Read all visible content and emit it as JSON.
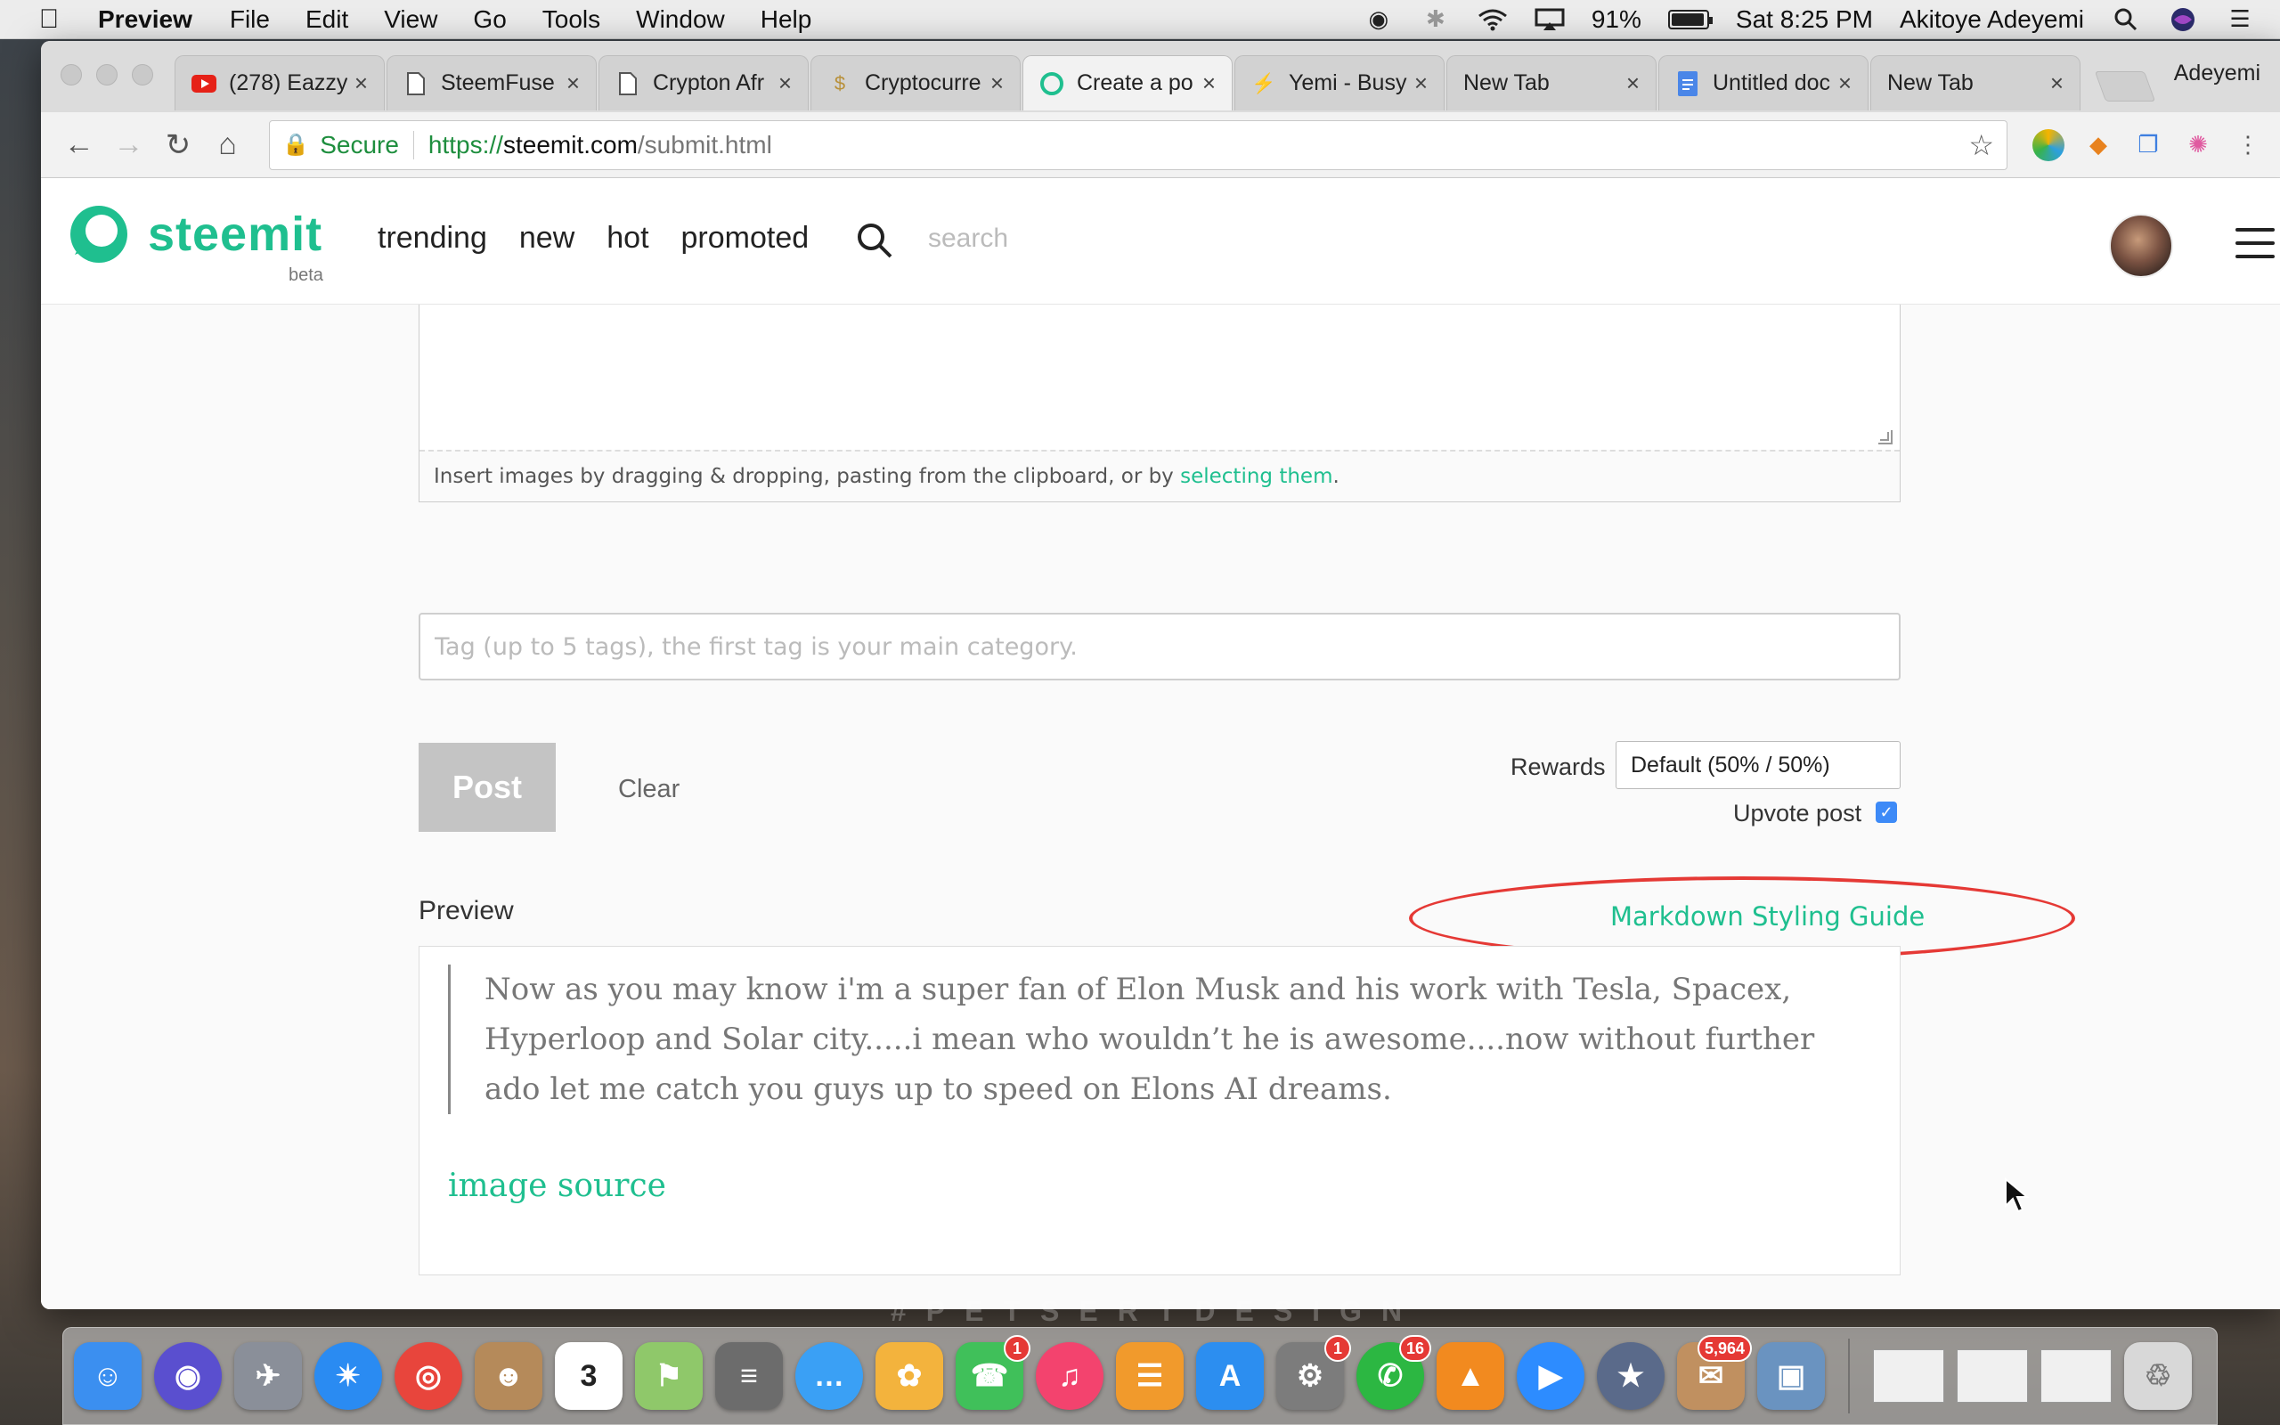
{
  "menubar": {
    "app_name": "Preview",
    "items": [
      "File",
      "Edit",
      "View",
      "Go",
      "Tools",
      "Window",
      "Help"
    ],
    "battery": "91%",
    "clock": "Sat 8:25 PM",
    "user": "Akitoye Adeyemi"
  },
  "browser": {
    "profile": "Adeyemi",
    "tabs": [
      {
        "title": "(278) Eazzy",
        "icon": "youtube-icon",
        "active": false
      },
      {
        "title": "SteemFuse",
        "icon": "page-icon",
        "active": false
      },
      {
        "title": "Crypton Afr",
        "icon": "page-icon",
        "active": false
      },
      {
        "title": "Cryptocurre",
        "icon": "coin-icon",
        "active": false
      },
      {
        "title": "Create a po",
        "icon": "steemit-icon",
        "active": true
      },
      {
        "title": "Yemi - Busy",
        "icon": "bolt-icon",
        "active": false
      },
      {
        "title": "New Tab",
        "icon": "",
        "active": false
      },
      {
        "title": "Untitled doc",
        "icon": "docs-icon",
        "active": false
      },
      {
        "title": "New Tab",
        "icon": "",
        "active": false
      }
    ],
    "address": {
      "secure_label": "Secure",
      "scheme": "https://",
      "host": "steemit.com",
      "path": "/submit.html"
    }
  },
  "site": {
    "logo_text": "steemit",
    "beta_label": "beta",
    "nav": [
      "trending",
      "new",
      "hot",
      "promoted"
    ],
    "search_placeholder": "search"
  },
  "editor": {
    "drop_hint_prefix": "Insert images by dragging & dropping, pasting from the clipboard, or by ",
    "drop_hint_link": "selecting them",
    "drop_hint_suffix": ".",
    "tag_placeholder": "Tag (up to 5 tags), the first tag is your main category.",
    "post_label": "Post",
    "clear_label": "Clear",
    "rewards_label": "Rewards",
    "rewards_value": "Default (50% / 50%)",
    "upvote_label": "Upvote post",
    "upvote_checked": true
  },
  "preview": {
    "label": "Preview",
    "guide_link": "Markdown Styling Guide",
    "quote": "Now as you may know i'm a super fan of Elon Musk and his work with Tesla, Spacex, Hyperloop and Solar city.....i mean who wouldn’t he is awesome....now without further ado let me catch you guys up to speed on Elons AI dreams.",
    "image_source": "image source"
  },
  "dock": {
    "watermark": "#PETSERTDESIGN",
    "apps": [
      {
        "name": "finder-icon",
        "color": "#3b8ff0",
        "badge": ""
      },
      {
        "name": "siri-icon",
        "color": "#5a4fcf",
        "badge": ""
      },
      {
        "name": "launchpad-icon",
        "color": "#8a8f99",
        "badge": ""
      },
      {
        "name": "safari-icon",
        "color": "#2a8bf2",
        "badge": ""
      },
      {
        "name": "chrome-icon",
        "color": "#e8453c",
        "badge": ""
      },
      {
        "name": "contacts-icon",
        "color": "#b58a5a",
        "badge": ""
      },
      {
        "name": "calendar-icon",
        "color": "#ffffff",
        "badge": ""
      },
      {
        "name": "maps-icon",
        "color": "#8fc86a",
        "badge": ""
      },
      {
        "name": "calculator-icon",
        "color": "#6c6c6c",
        "badge": ""
      },
      {
        "name": "messages-icon",
        "color": "#3aa0f5",
        "badge": ""
      },
      {
        "name": "photos-icon",
        "color": "#f3b33d",
        "badge": ""
      },
      {
        "name": "facetime-icon",
        "color": "#40c05a",
        "badge": "1"
      },
      {
        "name": "itunes-icon",
        "color": "#f3436e",
        "badge": ""
      },
      {
        "name": "ibooks-icon",
        "color": "#f19a2c",
        "badge": ""
      },
      {
        "name": "app-store-icon",
        "color": "#2c8ef0",
        "badge": ""
      },
      {
        "name": "system-preferences-icon",
        "color": "#7c7c7c",
        "badge": "1"
      },
      {
        "name": "whatsapp-icon",
        "color": "#2cb742",
        "badge": "16"
      },
      {
        "name": "vlc-icon",
        "color": "#f28a1f",
        "badge": ""
      },
      {
        "name": "zoom-icon",
        "color": "#2d8cff",
        "badge": ""
      },
      {
        "name": "ubar-icon",
        "color": "#5a6a8a",
        "badge": ""
      },
      {
        "name": "mail-icon",
        "color": "#c09060",
        "badge": "5,964"
      },
      {
        "name": "preview-icon",
        "color": "#6a93c0",
        "badge": ""
      }
    ]
  }
}
